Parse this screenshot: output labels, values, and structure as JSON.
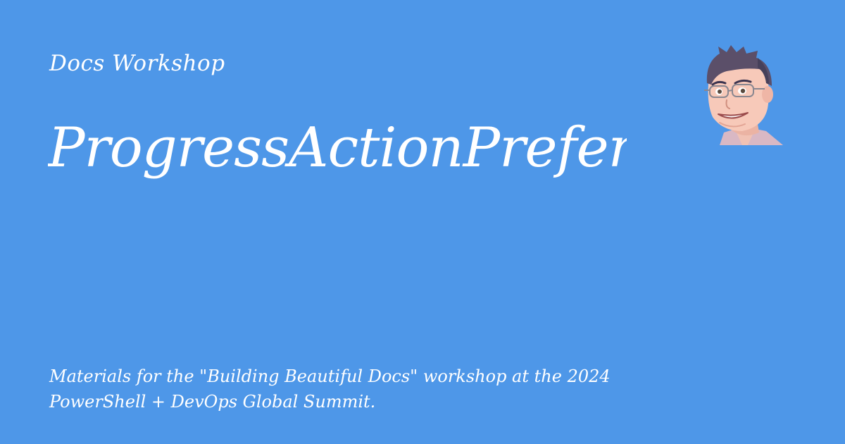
{
  "site": {
    "name": "Docs Workshop"
  },
  "page": {
    "title": "ProgressActionPreference",
    "description": "Materials for the \"Building Beautiful Docs\" workshop at the 2024 PowerShell + DevOps Global Summit."
  },
  "colors": {
    "background": "#4e97e8",
    "text": "#ffffff"
  },
  "avatar": {
    "icon": "cartoon-avatar-icon"
  }
}
